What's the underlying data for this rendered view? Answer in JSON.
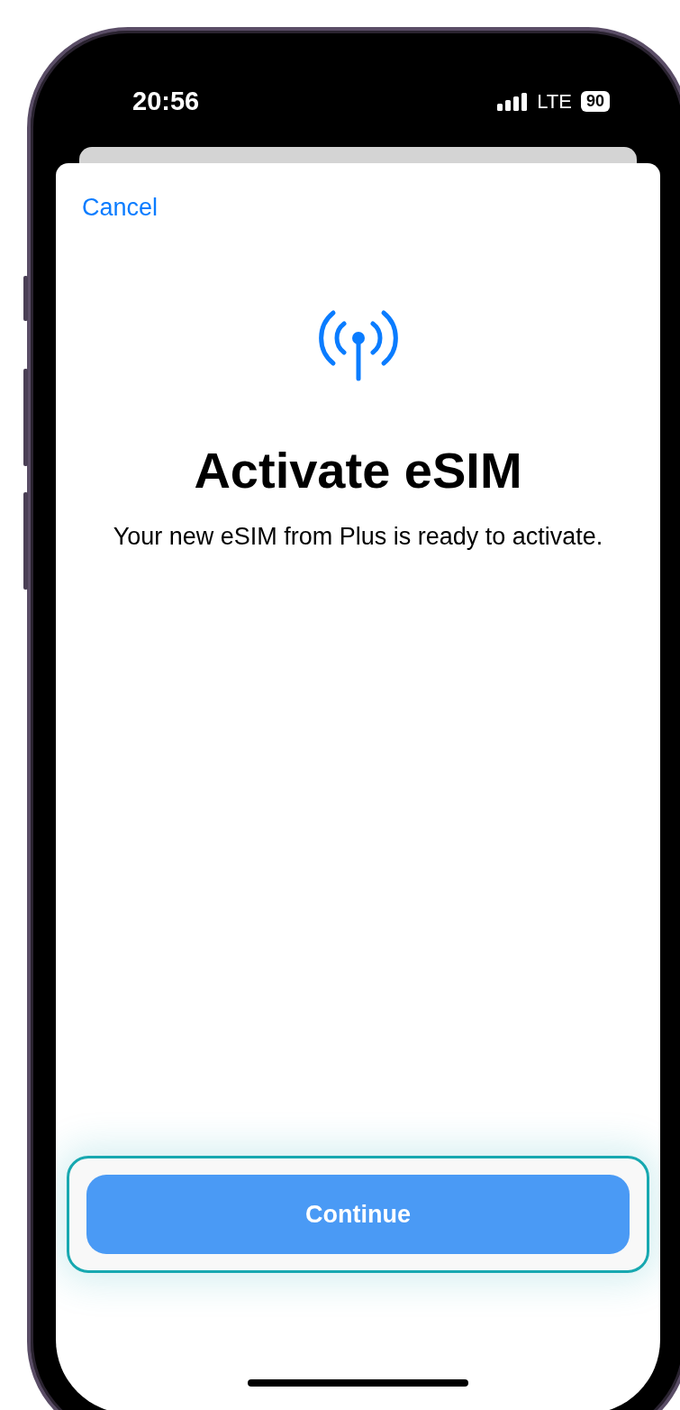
{
  "status_bar": {
    "time": "20:56",
    "network": "LTE",
    "battery": "90"
  },
  "sheet": {
    "cancel": "Cancel",
    "title": "Activate eSIM",
    "subtitle": "Your new eSIM from Plus is ready to activate.",
    "button": {
      "label": "Continue",
      "highlighted": true
    }
  }
}
